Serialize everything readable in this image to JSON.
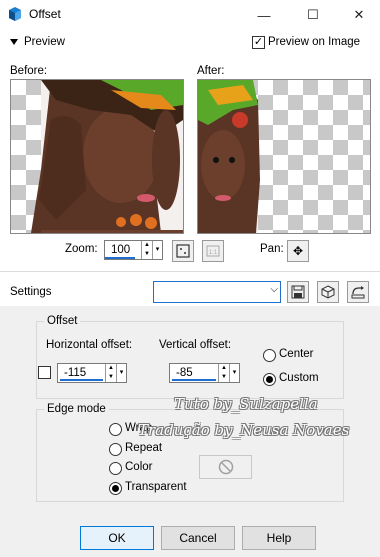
{
  "window": {
    "title": "Offset",
    "controls": {
      "minimize": "—",
      "maximize": "☐",
      "close": "✕"
    }
  },
  "preview": {
    "toggle_label": "Preview",
    "preview_on_image_label": "Preview on Image",
    "preview_on_image_checked": true,
    "before_label": "Before:",
    "after_label": "After:",
    "zoom_label": "Zoom:",
    "zoom_value": "100",
    "pan_label": "Pan:"
  },
  "settings": {
    "label": "Settings",
    "preset_value": ""
  },
  "offset": {
    "group_label": "Offset",
    "horizontal_label": "Horizontal offset:",
    "horizontal_value": "-115",
    "vertical_label": "Vertical offset:",
    "vertical_value": "-85",
    "center_label": "Center",
    "custom_label": "Custom",
    "selected": "Custom"
  },
  "edge_mode": {
    "group_label": "Edge mode",
    "options": [
      "Wrap",
      "Repeat",
      "Color",
      "Transparent"
    ],
    "selected": "Transparent"
  },
  "watermark": {
    "line1": "Tuto by_Sulzapella",
    "line2": "Tradução by_Neusa Novaes"
  },
  "buttons": {
    "ok": "OK",
    "cancel": "Cancel",
    "help": "Help"
  },
  "colors": {
    "accent": "#0078d7",
    "panel": "#f0f0f0"
  }
}
